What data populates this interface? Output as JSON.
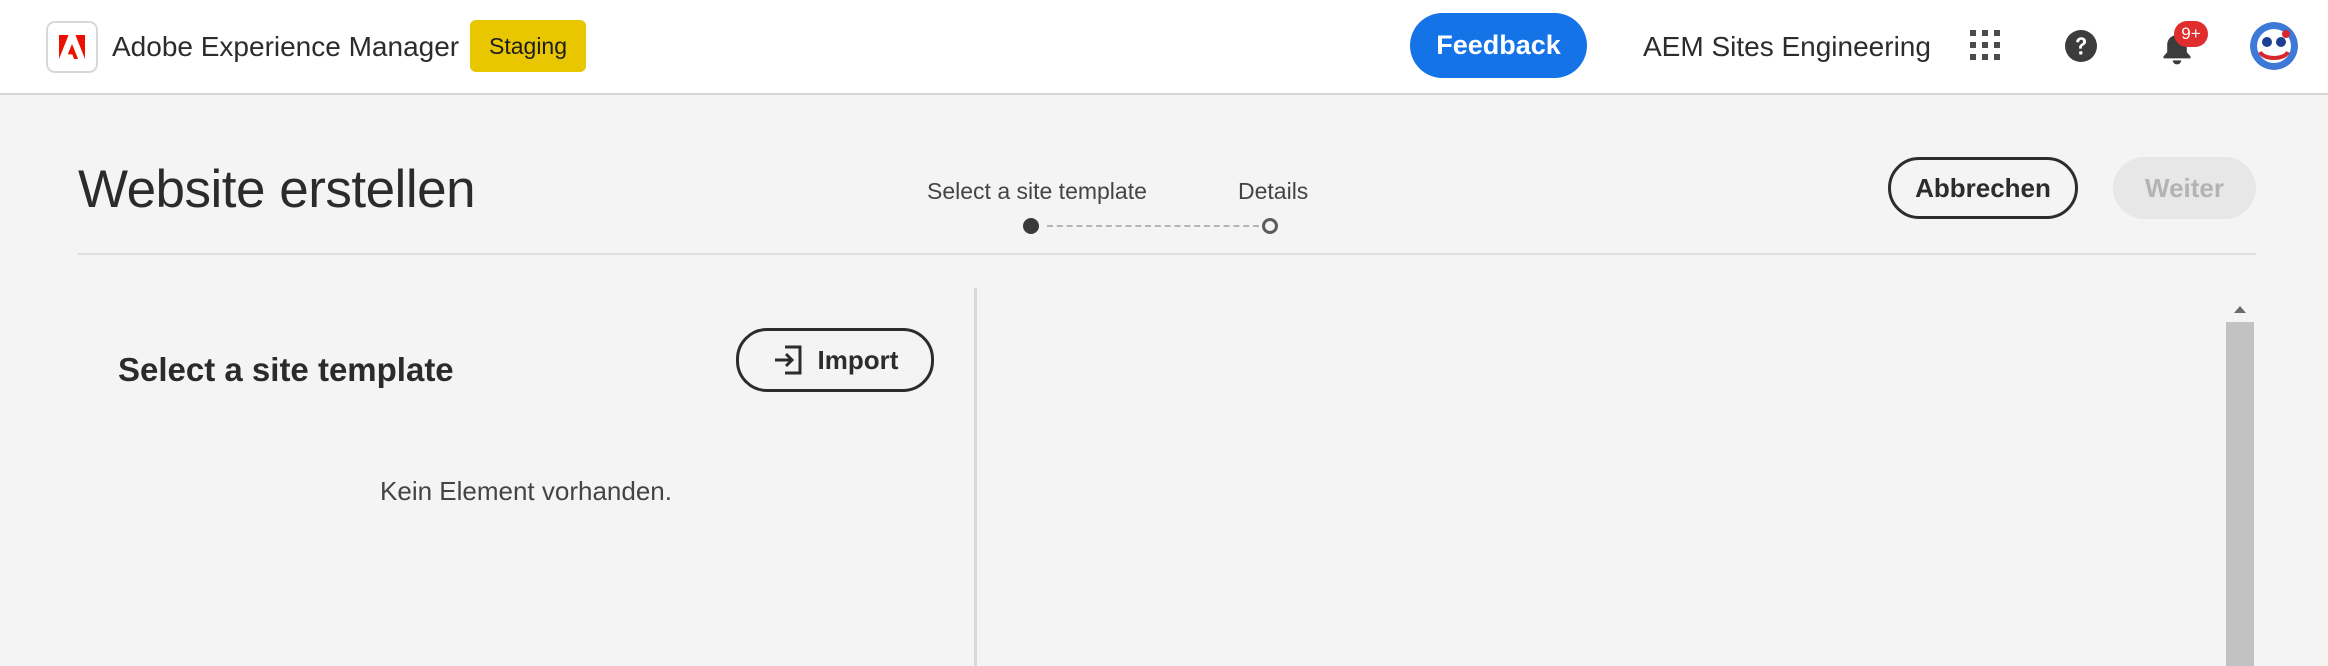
{
  "header": {
    "app_title": "Adobe Experience Manager",
    "environment_badge": "Staging",
    "feedback_label": "Feedback",
    "org_name": "AEM Sites Engineering",
    "notification_count": "9+",
    "icons": [
      "adobe-logo-icon",
      "app-grid-icon",
      "help-icon",
      "bell-icon",
      "avatar"
    ]
  },
  "wizard": {
    "title": "Website erstellen",
    "steps": [
      {
        "label": "Select a site template",
        "state": "active"
      },
      {
        "label": "Details",
        "state": "pending"
      }
    ],
    "cancel_label": "Abbrechen",
    "next_label": "Weiter"
  },
  "template_panel": {
    "title": "Select a site template",
    "import_label": "Import",
    "empty_message": "Kein Element vorhanden."
  },
  "colors": {
    "brand_red": "#eb1000",
    "accent_blue": "#1473e6",
    "staging_yellow": "#e8c600",
    "notification_red": "#e02d2d"
  }
}
